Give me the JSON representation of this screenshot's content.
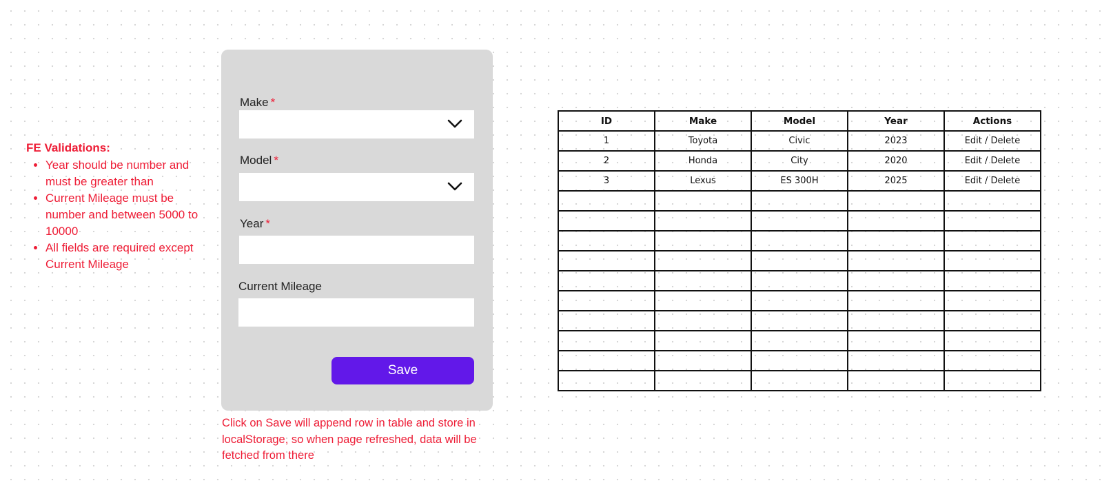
{
  "validations": {
    "title": "FE Validations:",
    "items": [
      "Year should be number and must be greater than",
      "Current Mileage must be number and between 5000 to 10000",
      "All fields are required except Current Mileage"
    ]
  },
  "form": {
    "make_label": "Make",
    "model_label": "Model",
    "year_label": "Year",
    "mileage_label": "Current Mileage",
    "required_marker": "*",
    "make_value": "",
    "model_value": "",
    "year_value": "",
    "mileage_value": "",
    "save_label": "Save"
  },
  "save_note": "Click on Save will append row in table and store in localStorage, so when page refreshed, data will be fetched from there",
  "table": {
    "columns": [
      "ID",
      "Make",
      "Model",
      "Year",
      "Actions"
    ],
    "rows": [
      [
        "1",
        "Toyota",
        "Civic",
        "2023",
        "Edit / Delete"
      ],
      [
        "2",
        "Honda",
        "City",
        "2020",
        "Edit / Delete"
      ],
      [
        "3",
        "Lexus",
        "ES 300H",
        "2025",
        "Edit / Delete"
      ],
      [
        "",
        "",
        "",
        "",
        ""
      ],
      [
        "",
        "",
        "",
        "",
        ""
      ],
      [
        "",
        "",
        "",
        "",
        ""
      ],
      [
        "",
        "",
        "",
        "",
        ""
      ],
      [
        "",
        "",
        "",
        "",
        ""
      ],
      [
        "",
        "",
        "",
        "",
        ""
      ],
      [
        "",
        "",
        "",
        "",
        ""
      ],
      [
        "",
        "",
        "",
        "",
        ""
      ],
      [
        "",
        "",
        "",
        "",
        ""
      ],
      [
        "",
        "",
        "",
        "",
        ""
      ]
    ]
  },
  "icons": {
    "select_arrow": "chevron-down-icon"
  },
  "colors": {
    "accent": "#6218e9",
    "note_red": "#ee1d36",
    "card_bg": "#d9d9d9"
  }
}
